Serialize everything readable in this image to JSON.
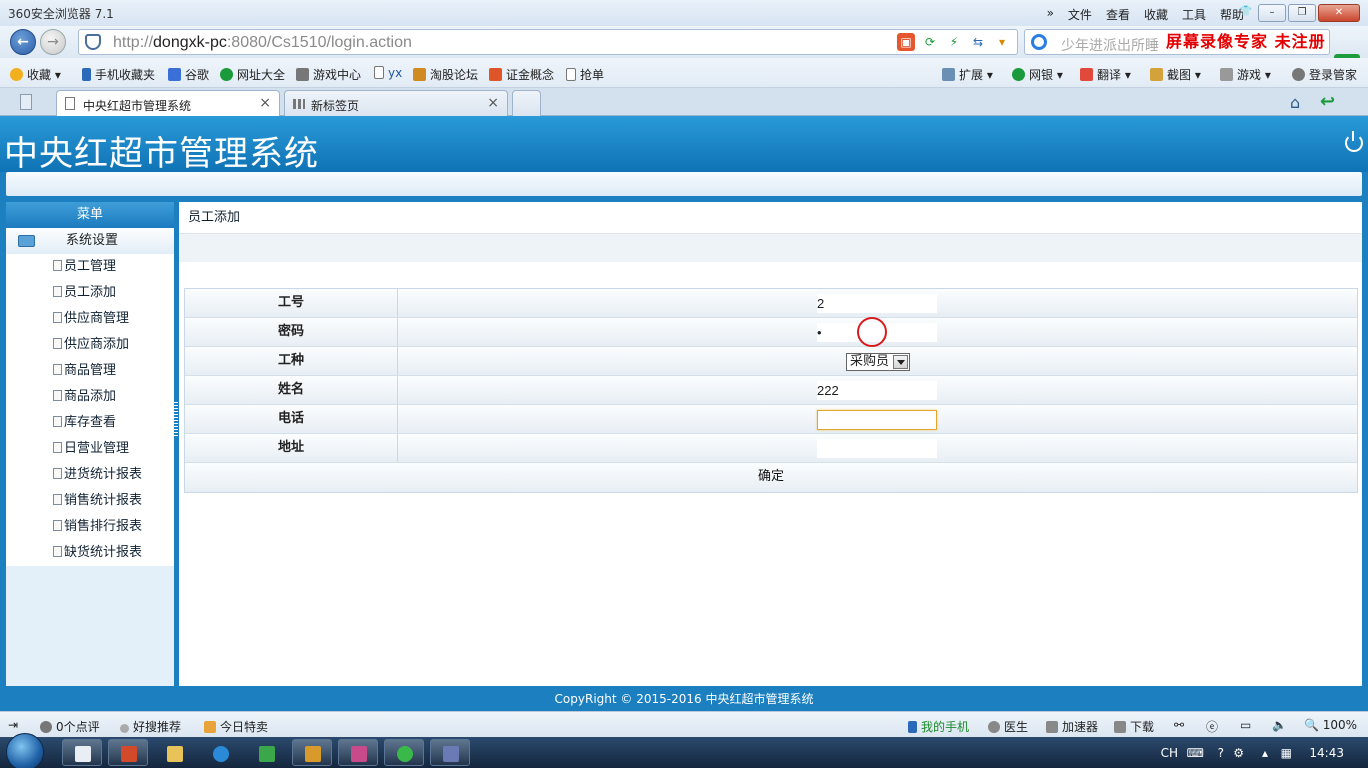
{
  "browser": {
    "app_title": "360安全浏览器 7.1",
    "menu": [
      "»",
      "文件",
      "查看",
      "收藏",
      "工具",
      "帮助"
    ],
    "url_prefix": "http://",
    "url_host": "dongxk-pc",
    "url_rest": ":8080/Cs1510/login.action",
    "search_placeholder": "少年进派出所睡",
    "watermark": "屏幕录像专家 未注册",
    "bookmarks": [
      "收藏",
      "手机收藏夹",
      "谷歌",
      "网址大全",
      "游戏中心",
      "yx",
      "淘股论坛",
      "证金概念",
      "抢单"
    ],
    "bookmarks_right": [
      "扩展",
      "网银",
      "翻译",
      "截图",
      "游戏",
      "登录管家"
    ],
    "tabs": [
      {
        "label": "中央红超市管理系统",
        "close": "×"
      },
      {
        "label": "新标签页",
        "close": "×"
      }
    ]
  },
  "app": {
    "title": "中央红超市管理系统",
    "sidebar": {
      "header": "菜单",
      "group": "系统设置",
      "items": [
        "员工管理",
        "员工添加",
        "供应商管理",
        "供应商添加",
        "商品管理",
        "商品添加",
        "库存查看",
        "日营业管理",
        "进货统计报表",
        "销售统计报表",
        "销售排行报表",
        "缺货统计报表"
      ]
    },
    "breadcrumb": "员工添加",
    "form": {
      "fields": [
        {
          "label": "工号",
          "value": "2"
        },
        {
          "label": "密码",
          "value": "•"
        },
        {
          "label": "工种",
          "value": "采购员"
        },
        {
          "label": "姓名",
          "value": "222"
        },
        {
          "label": "电话",
          "value": ""
        },
        {
          "label": "地址",
          "value": ""
        }
      ],
      "submit": "确定"
    },
    "footer": "CopyRight © 2015-2016 中央红超市管理系统"
  },
  "statusbar": {
    "left": [
      "0个点评",
      "好搜推荐",
      "今日特卖"
    ],
    "right": [
      "我的手机",
      "医生",
      "加速器",
      "下载",
      "100%"
    ]
  },
  "taskbar": {
    "lang": "CH",
    "time": "14:43"
  }
}
